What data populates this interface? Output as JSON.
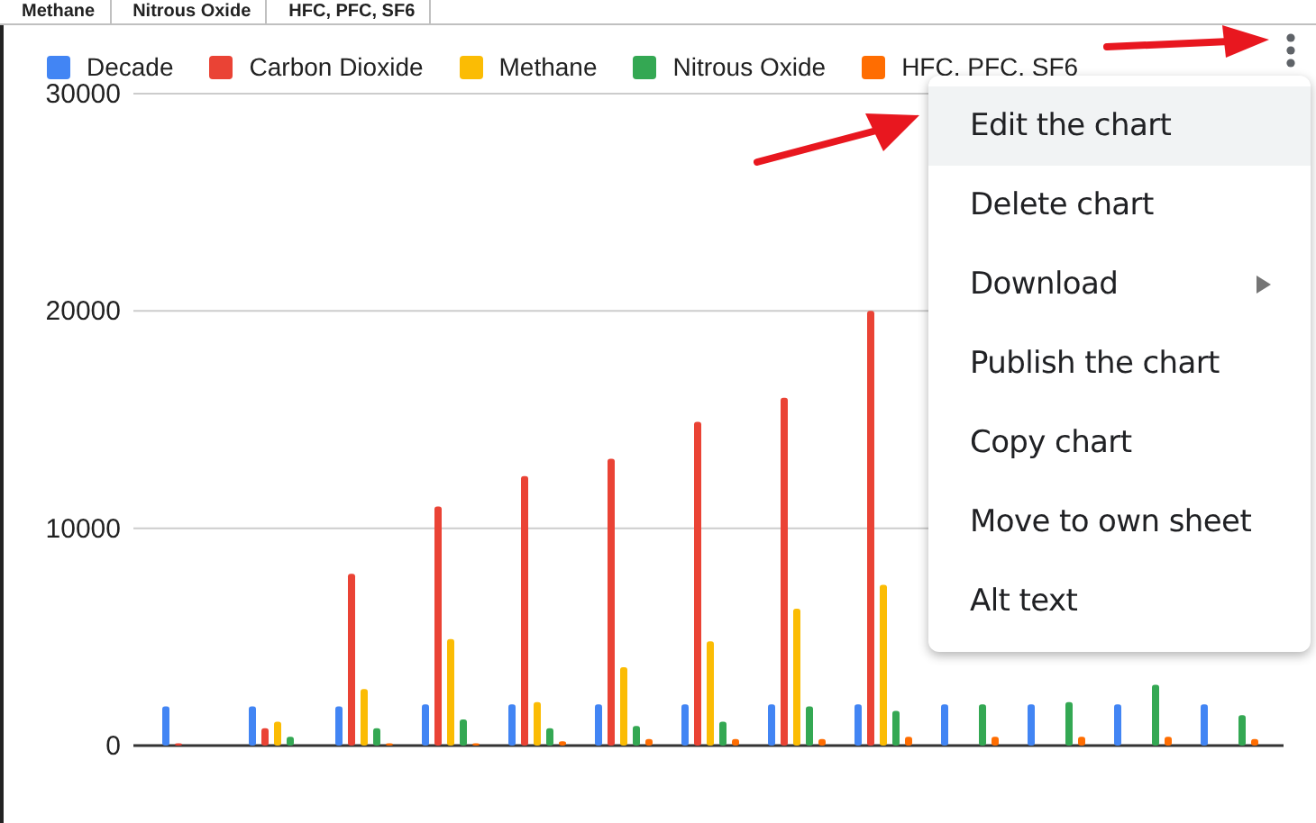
{
  "sheet_header": [
    "Methane",
    "Nitrous Oxide",
    "HFC, PFC, SF6"
  ],
  "chart": {
    "chart_data": {
      "type": "bar",
      "legend": "top",
      "ylim": [
        0,
        30000
      ],
      "yticks": [
        0,
        10000,
        20000,
        30000
      ],
      "series": [
        {
          "name": "Decade",
          "color": "#4285f4",
          "values": [
            1800,
            1800,
            1800,
            1900,
            1900,
            1900,
            1900,
            1900,
            1900,
            1900,
            1900,
            1900,
            1900
          ]
        },
        {
          "name": "Carbon Dioxide",
          "color": "#ea4335",
          "values": [
            100,
            800,
            7900,
            11000,
            12400,
            13200,
            14900,
            16000,
            20000,
            null,
            null,
            null,
            null
          ]
        },
        {
          "name": "Methane",
          "color": "#fbbc04",
          "values": [
            0,
            1100,
            2600,
            4900,
            2000,
            3600,
            4800,
            6300,
            7400,
            null,
            null,
            null,
            null
          ]
        },
        {
          "name": "Nitrous Oxide",
          "color": "#34a853",
          "values": [
            0,
            400,
            800,
            1200,
            800,
            900,
            1100,
            1800,
            1600,
            1900,
            2000,
            2800,
            1400
          ]
        },
        {
          "name": "HFC, PFC, SF6",
          "color": "#ff6d01",
          "values": [
            0,
            0,
            100,
            100,
            200,
            300,
            300,
            300,
            400,
            400,
            400,
            400,
            300
          ]
        }
      ]
    }
  },
  "menu": {
    "items": [
      {
        "label": "Edit the chart",
        "selected": true,
        "has_submenu": false
      },
      {
        "label": "Delete chart",
        "selected": false,
        "has_submenu": false
      },
      {
        "label": "Download",
        "selected": false,
        "has_submenu": true
      },
      {
        "label": "Publish the chart",
        "selected": false,
        "has_submenu": false
      },
      {
        "label": "Copy chart",
        "selected": false,
        "has_submenu": false
      },
      {
        "label": "Move to own sheet",
        "selected": false,
        "has_submenu": false
      },
      {
        "label": "Alt text",
        "selected": false,
        "has_submenu": false
      }
    ]
  }
}
